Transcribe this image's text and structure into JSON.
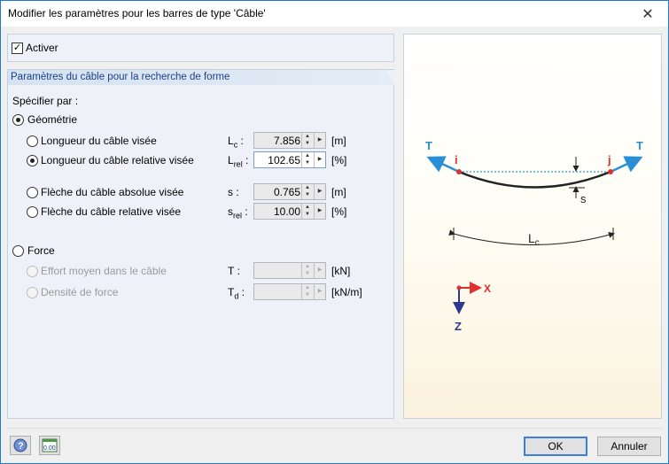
{
  "window": {
    "title": "Modifier les paramètres pour les barres de type 'Câble'",
    "close_glyph": "✕"
  },
  "activer": {
    "label": "Activer",
    "checked": true
  },
  "section": {
    "title": "Paramètres du câble pour la recherche de forme",
    "specify_label": "Spécifier par :",
    "geometry_label": "Géométrie",
    "force_label": "Force"
  },
  "rows": {
    "lc": {
      "label": "Longueur du câble visée",
      "sym": "L",
      "sub": "c",
      "colon": " :",
      "value": "7.856",
      "unit": "[m]"
    },
    "lrel": {
      "label": "Longueur du câble relative visée",
      "sym": "L",
      "sub": "rel",
      "colon": " :",
      "value": "102.65",
      "unit": "[%]"
    },
    "s": {
      "label": "Flèche du câble absolue visée",
      "sym": "s",
      "sub": "",
      "colon": " :",
      "value": "0.765",
      "unit": "[m]"
    },
    "srel": {
      "label": "Flèche du câble relative visée",
      "sym": "s",
      "sub": "rel",
      "colon": " :",
      "value": "10.00",
      "unit": "[%]"
    },
    "t": {
      "label": "Effort moyen dans le câble",
      "sym": "T",
      "sub": "",
      "colon": " :",
      "value": "",
      "unit": "[kN]"
    },
    "td": {
      "label": "Densité de force",
      "sym": "T",
      "sub": "d",
      "colon": " :",
      "value": "",
      "unit": "[kN/m]"
    }
  },
  "diagram": {
    "t_left": "T",
    "t_right": "T",
    "i_label": "i",
    "j_label": "j",
    "s_label": "s",
    "lc_label": "L",
    "lc_sub": "c",
    "x_label": "X",
    "z_label": "Z",
    "colors": {
      "arrow": "#2b8fd6",
      "node": "#e0302e",
      "axis_z": "#2b3a8f",
      "dotted": "#4aa6e0"
    }
  },
  "buttons": {
    "ok": "OK",
    "cancel": "Annuler",
    "units_icon_text": "0.00"
  },
  "icons": [
    "close-icon",
    "check-icon",
    "help-icon",
    "units-icon",
    "spin-up-icon",
    "spin-down-icon",
    "menu-arrow-icon"
  ]
}
